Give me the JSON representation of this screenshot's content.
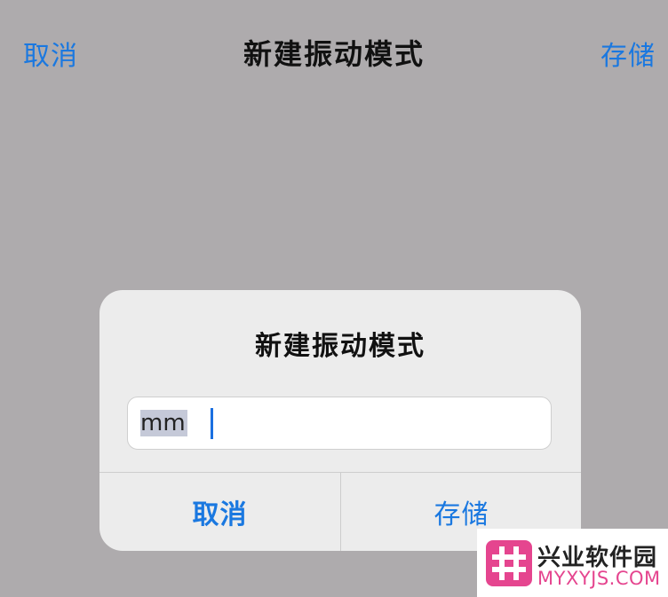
{
  "nav": {
    "left_label": "取消",
    "title": "新建振动模式",
    "right_label": "存储"
  },
  "dialog": {
    "title": "新建振动模式",
    "input_value": "mm",
    "cancel_label": "取消",
    "save_label": "存储"
  },
  "watermark": {
    "name": "兴业软件园",
    "url": "MYXYJS.COM",
    "color": "#e5458f"
  }
}
